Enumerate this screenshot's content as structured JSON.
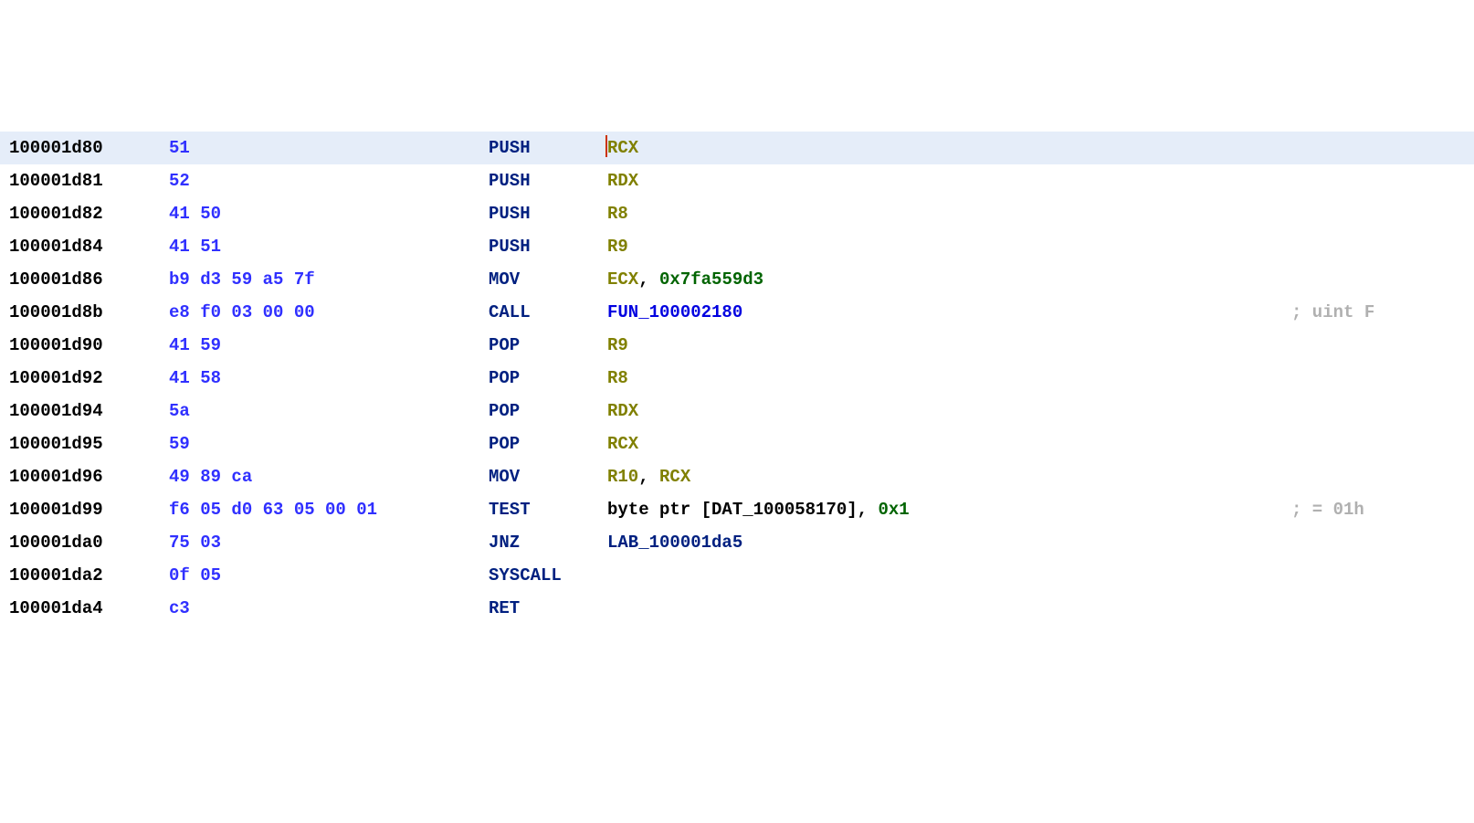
{
  "rows": [
    {
      "addr": "100001d80",
      "bytes": "51",
      "mnem": "PUSH",
      "ops": [
        {
          "t": "reg",
          "v": "RCX"
        }
      ],
      "comment": "",
      "selected": true,
      "cursor": true
    },
    {
      "addr": "100001d81",
      "bytes": "52",
      "mnem": "PUSH",
      "ops": [
        {
          "t": "reg",
          "v": "RDX"
        }
      ],
      "comment": ""
    },
    {
      "addr": "100001d82",
      "bytes": "41 50",
      "mnem": "PUSH",
      "ops": [
        {
          "t": "reg",
          "v": "R8"
        }
      ],
      "comment": ""
    },
    {
      "addr": "100001d84",
      "bytes": "41 51",
      "mnem": "PUSH",
      "ops": [
        {
          "t": "reg",
          "v": "R9"
        }
      ],
      "comment": ""
    },
    {
      "addr": "100001d86",
      "bytes": "b9 d3 59 a5 7f",
      "mnem": "MOV",
      "ops": [
        {
          "t": "reg",
          "v": "ECX"
        },
        {
          "t": "txt",
          "v": ", "
        },
        {
          "t": "num",
          "v": "0x7fa559d3"
        }
      ],
      "comment": ""
    },
    {
      "addr": "100001d8b",
      "bytes": "e8 f0 03 00 00",
      "mnem": "CALL",
      "ops": [
        {
          "t": "func",
          "v": "FUN_100002180"
        }
      ],
      "comment": "; uint F"
    },
    {
      "addr": "100001d90",
      "bytes": "41 59",
      "mnem": "POP",
      "ops": [
        {
          "t": "reg",
          "v": "R9"
        }
      ],
      "comment": ""
    },
    {
      "addr": "100001d92",
      "bytes": "41 58",
      "mnem": "POP",
      "ops": [
        {
          "t": "reg",
          "v": "R8"
        }
      ],
      "comment": ""
    },
    {
      "addr": "100001d94",
      "bytes": "5a",
      "mnem": "POP",
      "ops": [
        {
          "t": "reg",
          "v": "RDX"
        }
      ],
      "comment": ""
    },
    {
      "addr": "100001d95",
      "bytes": "59",
      "mnem": "POP",
      "ops": [
        {
          "t": "reg",
          "v": "RCX"
        }
      ],
      "comment": ""
    },
    {
      "addr": "100001d96",
      "bytes": "49 89 ca",
      "mnem": "MOV",
      "ops": [
        {
          "t": "reg",
          "v": "R10"
        },
        {
          "t": "txt",
          "v": ", "
        },
        {
          "t": "reg",
          "v": "RCX"
        }
      ],
      "comment": ""
    },
    {
      "addr": "100001d99",
      "bytes": "f6 05 d0 63 05 00 01",
      "mnem": "TEST",
      "ops": [
        {
          "t": "txt",
          "v": "byte ptr ["
        },
        {
          "t": "dat",
          "v": "DAT_100058170"
        },
        {
          "t": "txt",
          "v": "], "
        },
        {
          "t": "num",
          "v": "0x1"
        }
      ],
      "comment": "; = 01h"
    },
    {
      "addr": "100001da0",
      "bytes": "75 03",
      "mnem": "JNZ",
      "ops": [
        {
          "t": "lab",
          "v": "LAB_100001da5"
        }
      ],
      "comment": ""
    },
    {
      "addr": "100001da2",
      "bytes": "0f 05",
      "mnem": "SYSCALL",
      "ops": [],
      "comment": ""
    },
    {
      "addr": "100001da4",
      "bytes": "c3",
      "mnem": "RET",
      "ops": [],
      "comment": ""
    }
  ]
}
